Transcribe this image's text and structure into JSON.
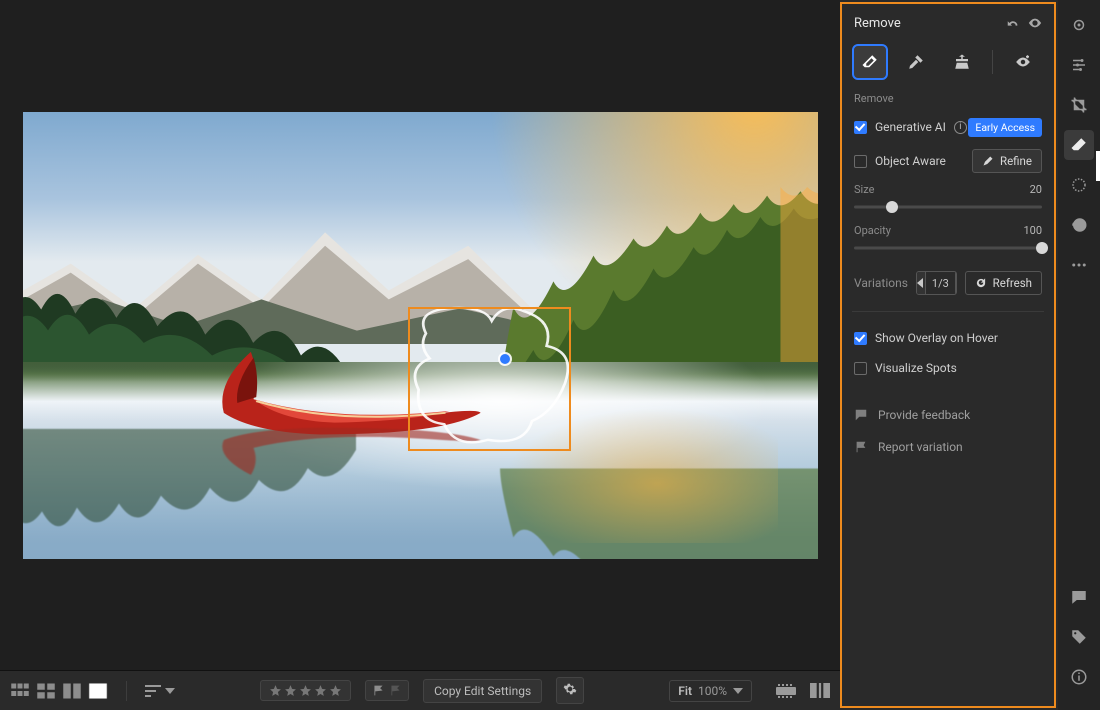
{
  "panel": {
    "title": "Remove",
    "section_label": "Remove",
    "gen_ai": {
      "label": "Generative AI",
      "checked": true,
      "badge": "Early Access"
    },
    "object_aware": {
      "label": "Object Aware",
      "checked": false,
      "refine": "Refine"
    },
    "size": {
      "label": "Size",
      "value": 20,
      "min": 0,
      "max": 100
    },
    "opacity": {
      "label": "Opacity",
      "value": 100,
      "min": 0,
      "max": 100
    },
    "variations": {
      "label": "Variations",
      "current": 1,
      "total": 3,
      "refresh": "Refresh"
    },
    "overlay": {
      "label": "Show Overlay on Hover",
      "checked": true
    },
    "visualize": {
      "label": "Visualize Spots",
      "checked": false
    },
    "feedback": "Provide feedback",
    "report": "Report variation"
  },
  "bottombar": {
    "copy_edit": "Copy Edit Settings",
    "fit_label": "Fit",
    "fit_value": "100%"
  },
  "colors": {
    "accent": "#2f7bff",
    "highlight": "#ee8b1e"
  }
}
